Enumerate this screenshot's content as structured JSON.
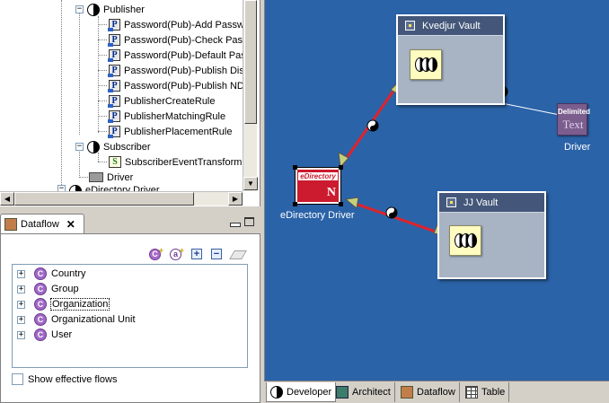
{
  "tree": {
    "nodes": [
      {
        "label": "Publisher",
        "icon": "yin-yang-icon",
        "expander": "⊟"
      },
      {
        "label": "Password(Pub)-Add Passw",
        "icon": "policy-icon"
      },
      {
        "label": "Password(Pub)-Check Pass",
        "icon": "policy-icon"
      },
      {
        "label": "Password(Pub)-Default Pas",
        "icon": "policy-icon"
      },
      {
        "label": "Password(Pub)-Publish Dist",
        "icon": "policy-icon"
      },
      {
        "label": "Password(Pub)-Publish NDS",
        "icon": "policy-icon"
      },
      {
        "label": "PublisherCreateRule",
        "icon": "policy-icon"
      },
      {
        "label": "PublisherMatchingRule",
        "icon": "policy-icon"
      },
      {
        "label": "PublisherPlacementRule",
        "icon": "policy-icon"
      },
      {
        "label": "Subscriber",
        "icon": "yin-yang-icon",
        "expander": "⊟"
      },
      {
        "label": "SubscriberEventTransform:",
        "icon": "stylesheet-icon"
      },
      {
        "label": "Driver",
        "icon": "driver-icon"
      },
      {
        "label": "eDirectory Driver",
        "icon": "yin-yang-icon",
        "expander": "⊟"
      }
    ]
  },
  "dataflow_view": {
    "tab_title": "Dataflow",
    "close_glyph": "✕",
    "toolbar": {
      "add_class_label": "C",
      "add_attribute_label": "a",
      "expand_all_label": "+",
      "collapse_all_label": "−"
    },
    "classes": [
      {
        "label": "Country",
        "icon_label": "C"
      },
      {
        "label": "Group",
        "icon_label": "C"
      },
      {
        "label": "Organization",
        "icon_label": "C",
        "selected": true
      },
      {
        "label": "Organizational Unit",
        "icon_label": "C"
      },
      {
        "label": "User",
        "icon_label": "C"
      }
    ],
    "expander_glyph": "+",
    "show_effective_flows_label": "Show effective flows",
    "show_effective_flows_checked": false
  },
  "canvas": {
    "vault_top": {
      "title": "Kvedjur Vault"
    },
    "vault_bottom": {
      "title": "JJ Vault"
    },
    "edirectory": {
      "brand": "eDirectory",
      "letter": "N",
      "label": "eDirectory Driver"
    },
    "delimited_text": {
      "line1": "Delimited",
      "line2": "Text",
      "label": "Driver"
    },
    "colors": {
      "background": "#2b63a8",
      "connection": "#e0232a",
      "arrow": "#c7d07a"
    }
  },
  "bottom_tabs": [
    {
      "label": "Developer",
      "icon": "developer-icon",
      "active": true
    },
    {
      "label": "Architect",
      "icon": "architect-icon",
      "active": false
    },
    {
      "label": "Dataflow",
      "icon": "dataflow-icon",
      "active": false
    },
    {
      "label": "Table",
      "icon": "table-icon",
      "active": false
    }
  ]
}
